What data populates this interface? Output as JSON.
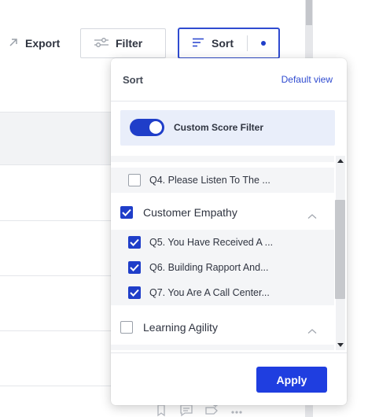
{
  "toolbar": {
    "export_label": "Export",
    "filter_label": "Filter",
    "sort_label": "Sort"
  },
  "sort_panel": {
    "title": "Sort",
    "default_view_link": "Default view",
    "toggle": {
      "label": "Custom Score Filter",
      "on": true
    },
    "list": {
      "rows": [
        {
          "type": "sub",
          "label": "Q4. Please Listen To The ...",
          "checked": false
        },
        {
          "type": "group",
          "label": "Customer Empathy",
          "checked": true,
          "expanded": true
        },
        {
          "type": "sub",
          "label": "Q5. You Have Received A ...",
          "checked": true
        },
        {
          "type": "sub",
          "label": "Q6. Building Rapport And...",
          "checked": true
        },
        {
          "type": "sub",
          "label": "Q7. You Are A Call Center...",
          "checked": true
        },
        {
          "type": "group",
          "label": "Learning Agility",
          "checked": false,
          "expanded": true
        }
      ]
    },
    "apply_label": "Apply"
  },
  "colors": {
    "accent": "#1f3ec9",
    "apply_button": "#1f3ee0",
    "toggle_card": "#e9eefa"
  }
}
